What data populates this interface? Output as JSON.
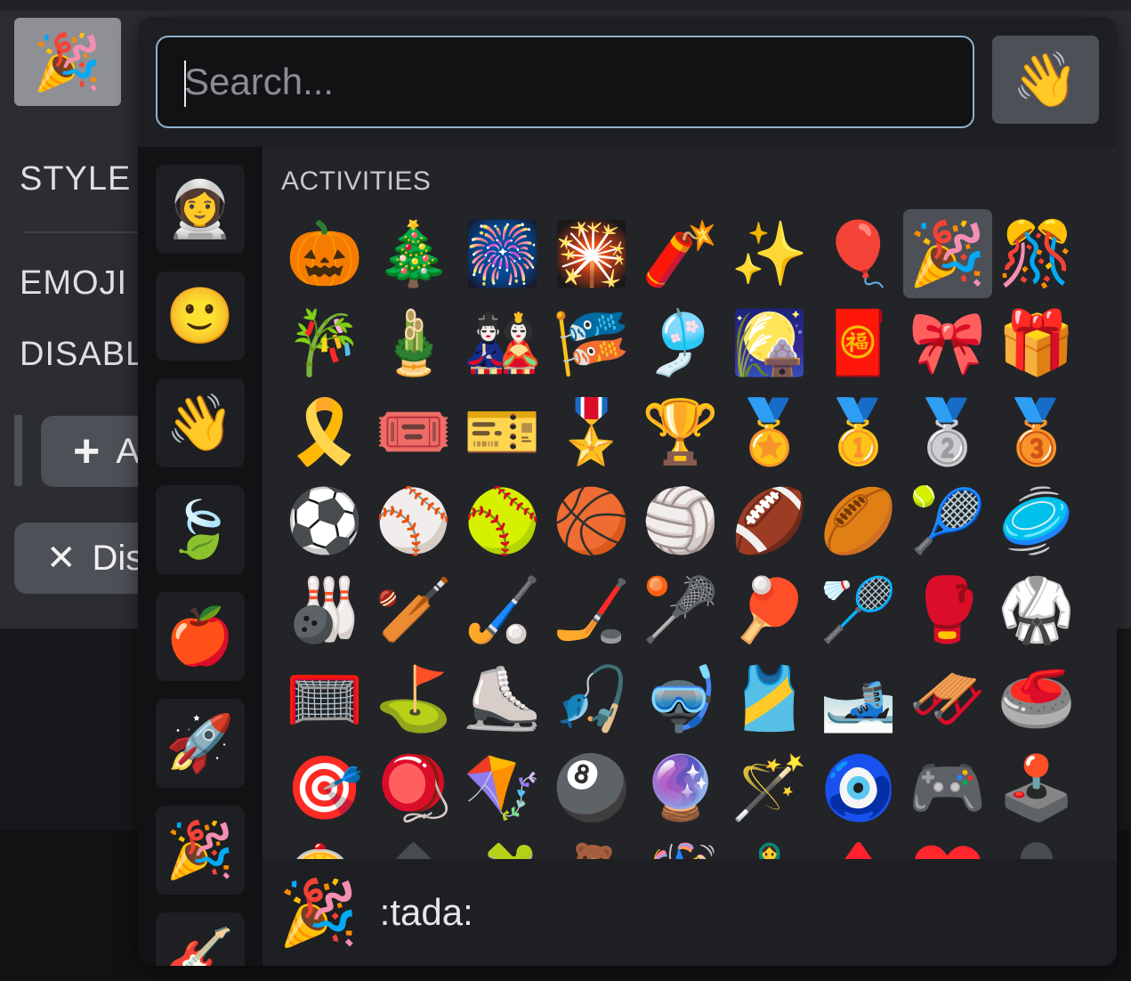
{
  "background": {
    "emoji_button": "🎉",
    "labels": [
      "STYLE",
      "EMOJI S",
      "DISABL"
    ],
    "add_button": {
      "icon": "+",
      "label": "A"
    },
    "disable_button": {
      "icon": "✕",
      "label": "Dis"
    }
  },
  "search": {
    "value": "",
    "placeholder": "Search..."
  },
  "skin_tone_button": "👋",
  "categories": [
    {
      "icon": "👩‍🚀",
      "name": "custom"
    },
    {
      "icon": "🙂",
      "name": "people"
    },
    {
      "icon": "👋",
      "name": "gestures"
    },
    {
      "icon": "🍃",
      "name": "nature"
    },
    {
      "icon": "🍎",
      "name": "food"
    },
    {
      "icon": "🚀",
      "name": "travel"
    },
    {
      "icon": "🎉",
      "name": "activities"
    },
    {
      "icon": "🎸",
      "name": "objects"
    }
  ],
  "section": {
    "title": "ACTIVITIES"
  },
  "emojis": [
    "🎃",
    "🎄",
    "🎆",
    "🎇",
    "🧨",
    "✨",
    "🎈",
    "🎉",
    "🎊",
    "🎋",
    "🎍",
    "🎎",
    "🎏",
    "🎐",
    "🎑",
    "🧧",
    "🎀",
    "🎁",
    "🎗️",
    "🎟️",
    "🎫",
    "🎖️",
    "🏆",
    "🏅",
    "🥇",
    "🥈",
    "🥉",
    "⚽",
    "⚾",
    "🥎",
    "🏀",
    "🏐",
    "🏈",
    "🏉",
    "🎾",
    "🥏",
    "🎳",
    "🏏",
    "🏑",
    "🏒",
    "🥍",
    "🏓",
    "🏸",
    "🥊",
    "🥋",
    "🥅",
    "⛳",
    "⛸️",
    "🎣",
    "🤿",
    "🎽",
    "🎿",
    "🛷",
    "🥌",
    "🎯",
    "🪀",
    "🪁",
    "🎱",
    "🔮",
    "🪄",
    "🧿",
    "🎮",
    "🕹️",
    "🎰",
    "♠️",
    "🧩",
    "🧸",
    "🪅",
    "🪆",
    "♦️",
    "♥️",
    "♣️"
  ],
  "selected_index": 7,
  "preview": {
    "emoji": "🎉",
    "name": ":tada:"
  }
}
